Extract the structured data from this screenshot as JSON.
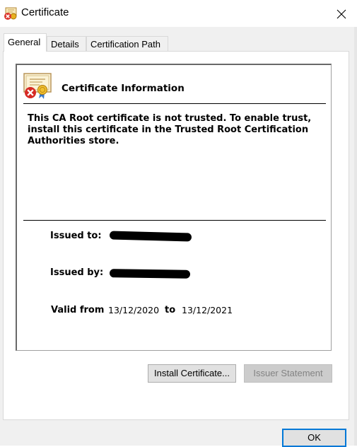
{
  "window": {
    "title": "Certificate",
    "icon": "certificate-error-icon",
    "close_icon": "close-icon"
  },
  "tabs": [
    {
      "label": "General",
      "active": true
    },
    {
      "label": "Details",
      "active": false
    },
    {
      "label": "Certification Path",
      "active": false
    }
  ],
  "general": {
    "header": "Certificate Information",
    "message": "This CA Root certificate is not trusted. To enable trust, install this certificate in the Trusted Root Certification Authorities store.",
    "issued_to_label": "Issued to:",
    "issued_by_label": "Issued by:",
    "valid_from_label": "Valid from",
    "valid_from": "13/12/2020",
    "valid_to_label": "to",
    "valid_to": "13/12/2021"
  },
  "buttons": {
    "install": "Install Certificate...",
    "issuer_statement": "Issuer Statement",
    "ok": "OK"
  },
  "colors": {
    "accent": "#0078d7",
    "disabled_text": "#838383"
  }
}
